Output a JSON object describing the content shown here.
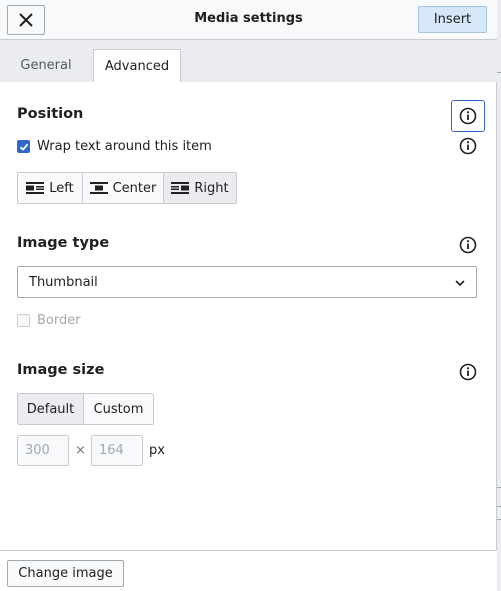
{
  "header": {
    "title": "Media settings",
    "close_icon": "close-icon",
    "insert_label": "Insert"
  },
  "tabs": [
    {
      "label": "General",
      "selected": false
    },
    {
      "label": "Advanced",
      "selected": true
    }
  ],
  "position": {
    "title": "Position",
    "wrap_label": "Wrap text around this item",
    "wrap_checked": true,
    "align_options": [
      {
        "label": "Left",
        "icon": "align-left-icon",
        "selected": false
      },
      {
        "label": "Center",
        "icon": "align-center-icon",
        "selected": false
      },
      {
        "label": "Right",
        "icon": "align-right-icon",
        "selected": true
      }
    ]
  },
  "image_type": {
    "title": "Image type",
    "selected": "Thumbnail",
    "border_label": "Border",
    "border_checked": false,
    "border_disabled": true
  },
  "image_size": {
    "title": "Image size",
    "options": [
      {
        "label": "Default",
        "selected": true
      },
      {
        "label": "Custom",
        "selected": false
      }
    ],
    "width": "300",
    "separator": "×",
    "height": "164",
    "unit": "px"
  },
  "footer": {
    "change_image_label": "Change image"
  },
  "colors": {
    "accent": "#3366cc",
    "primary_button_bg": "#d6e7f7",
    "border": "#c8ccd1",
    "text": "#202122"
  }
}
